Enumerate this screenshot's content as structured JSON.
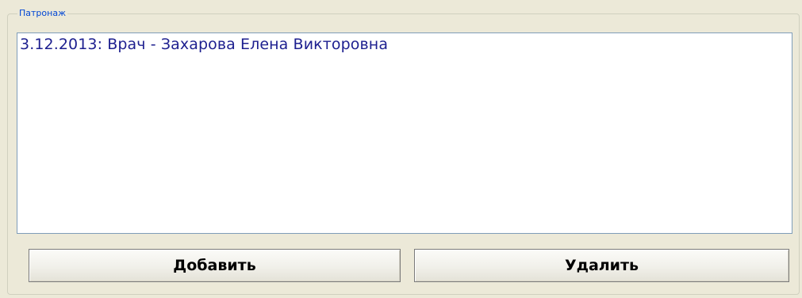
{
  "groupbox": {
    "title": "Патронаж"
  },
  "list": {
    "items": [
      "3.12.2013: Врач - Захарова Елена Викторовна"
    ]
  },
  "buttons": {
    "add_label": "Добавить",
    "delete_label": "Удалить"
  },
  "colors": {
    "background": "#ece9d8",
    "legend_text": "#0046d5",
    "list_text": "#1d1f8f",
    "list_border": "#7f9db9"
  }
}
